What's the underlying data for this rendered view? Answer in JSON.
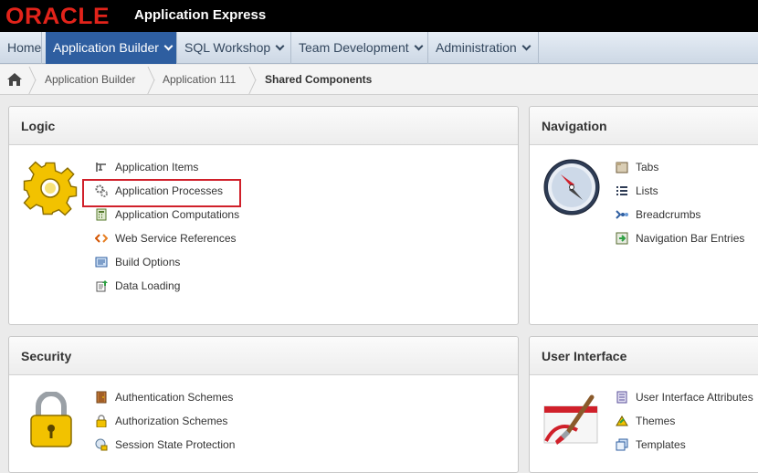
{
  "header": {
    "logo": "ORACLE",
    "product": "Application Express"
  },
  "nav": {
    "tabs": [
      {
        "label": "Home"
      },
      {
        "label": "Application Builder"
      },
      {
        "label": "SQL Workshop"
      },
      {
        "label": "Team Development"
      },
      {
        "label": "Administration"
      }
    ]
  },
  "breadcrumb": {
    "items": [
      "Application Builder",
      "Application 111"
    ],
    "current": "Shared Components"
  },
  "panels": {
    "logic": {
      "title": "Logic",
      "items": [
        "Application Items",
        "Application Processes",
        "Application Computations",
        "Web Service References",
        "Build Options",
        "Data Loading"
      ]
    },
    "navigation": {
      "title": "Navigation",
      "items": [
        "Tabs",
        "Lists",
        "Breadcrumbs",
        "Navigation Bar Entries"
      ]
    },
    "security": {
      "title": "Security",
      "items": [
        "Authentication Schemes",
        "Authorization Schemes",
        "Session State Protection"
      ]
    },
    "user_interface": {
      "title": "User Interface",
      "items": [
        "User Interface Attributes",
        "Themes",
        "Templates"
      ]
    }
  },
  "colors": {
    "accent": "#2e5ea0",
    "highlight": "#d0202a",
    "brand": "#e2231a"
  }
}
